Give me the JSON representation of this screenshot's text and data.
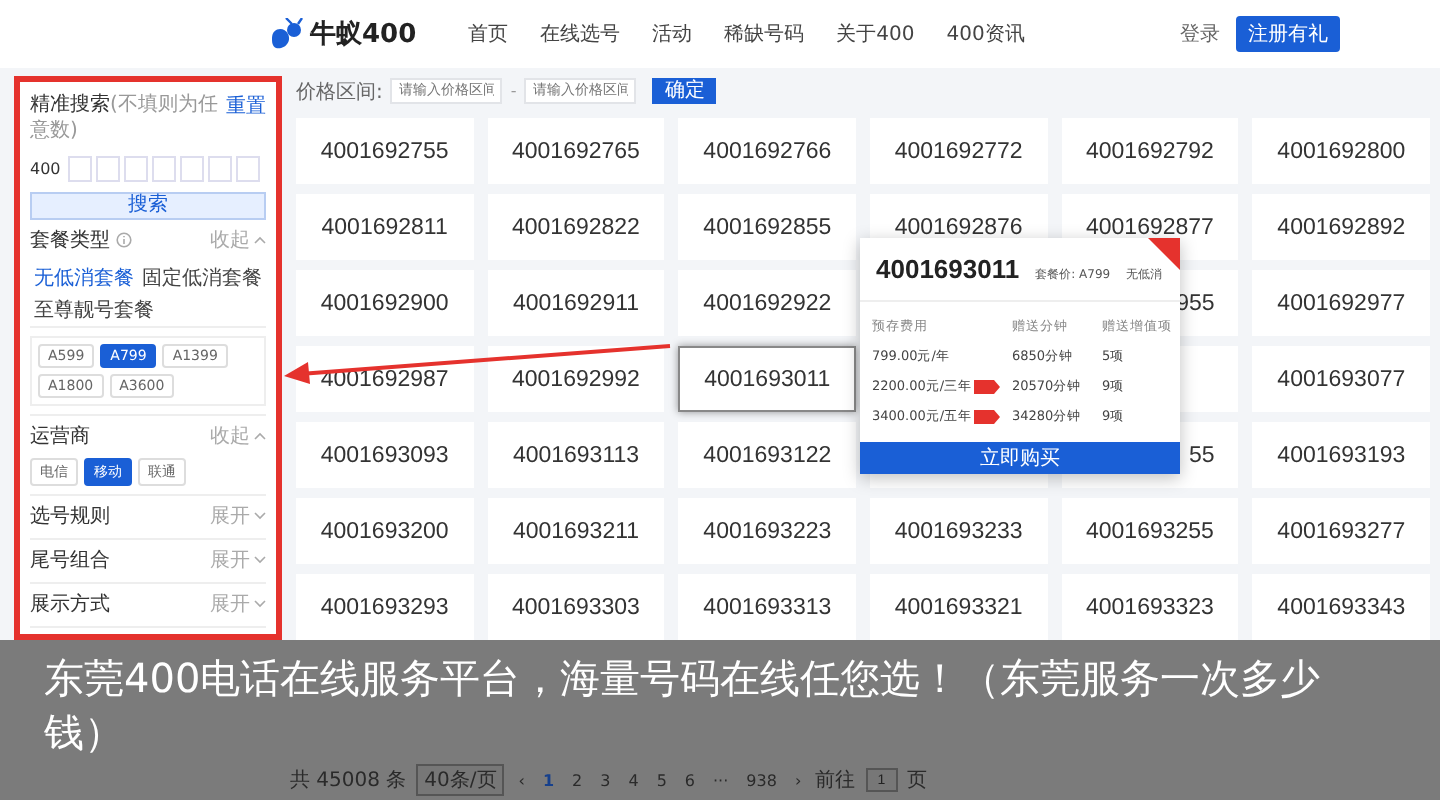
{
  "header": {
    "logo": "牛蚁400",
    "nav": [
      "首页",
      "在线选号",
      "活动",
      "稀缺号码",
      "关于400",
      "400资讯"
    ],
    "login": "登录",
    "register": "注册有礼"
  },
  "sidebar": {
    "search": {
      "title": "精准搜索",
      "hint": "(不填则为任意数)",
      "reset": "重置",
      "prefix": "400",
      "button": "搜索"
    },
    "sections": [
      {
        "title": "套餐类型",
        "info": true,
        "toggle": "收起",
        "expanded": true,
        "tabs": [
          {
            "label": "无低消套餐",
            "selected": true
          },
          {
            "label": "固定低消套餐",
            "selected": false
          },
          {
            "label": "至尊靓号套餐",
            "selected": false
          }
        ],
        "options": [
          {
            "label": "A599",
            "selected": false
          },
          {
            "label": "A799",
            "selected": true
          },
          {
            "label": "A1399",
            "selected": false
          },
          {
            "label": "A1800",
            "selected": false
          },
          {
            "label": "A3600",
            "selected": false
          }
        ]
      },
      {
        "title": "运营商",
        "info": false,
        "toggle": "收起",
        "expanded": true,
        "options": [
          {
            "label": "电信",
            "selected": false
          },
          {
            "label": "移动",
            "selected": true
          },
          {
            "label": "联通",
            "selected": false
          }
        ]
      },
      {
        "title": "选号规则",
        "info": false,
        "toggle": "展开",
        "expanded": false
      },
      {
        "title": "尾号组合",
        "info": false,
        "toggle": "展开",
        "expanded": false
      },
      {
        "title": "展示方式",
        "info": false,
        "toggle": "展开",
        "expanded": false
      }
    ]
  },
  "filter": {
    "label": "价格区间:",
    "min_placeholder": "请输入价格区间",
    "separator": "-",
    "max_placeholder": "请输入价格区间",
    "button": "确定"
  },
  "numbers": [
    {
      "kind": "full",
      "text": "4001692755",
      "selected": false
    },
    {
      "kind": "full",
      "text": "4001692765",
      "selected": false
    },
    {
      "kind": "full",
      "text": "4001692766",
      "selected": false
    },
    {
      "kind": "full",
      "text": "4001692772",
      "selected": false
    },
    {
      "kind": "full",
      "text": "4001692792",
      "selected": false
    },
    {
      "kind": "full",
      "text": "4001692800",
      "selected": false
    },
    {
      "kind": "full",
      "text": "4001692811",
      "selected": false
    },
    {
      "kind": "full",
      "text": "4001692822",
      "selected": false
    },
    {
      "kind": "full",
      "text": "4001692855",
      "selected": false
    },
    {
      "kind": "full",
      "text": "4001692876",
      "selected": false
    },
    {
      "kind": "full",
      "text": "4001692877",
      "selected": false
    },
    {
      "kind": "full",
      "text": "4001692892",
      "selected": false
    },
    {
      "kind": "full",
      "text": "4001692900",
      "selected": false
    },
    {
      "kind": "full",
      "text": "4001692911",
      "selected": false
    },
    {
      "kind": "full",
      "text": "4001692922",
      "selected": false
    },
    {
      "kind": "covered"
    },
    {
      "kind": "partial",
      "text": "955",
      "selected": false
    },
    {
      "kind": "full",
      "text": "4001692977",
      "selected": false
    },
    {
      "kind": "full",
      "text": "4001692987",
      "selected": false
    },
    {
      "kind": "full",
      "text": "4001692992",
      "selected": false
    },
    {
      "kind": "full",
      "text": "4001693011",
      "selected": true
    },
    {
      "kind": "covered"
    },
    {
      "kind": "hidden"
    },
    {
      "kind": "full",
      "text": "4001693077",
      "selected": false
    },
    {
      "kind": "full",
      "text": "4001693093",
      "selected": false
    },
    {
      "kind": "full",
      "text": "4001693113",
      "selected": false
    },
    {
      "kind": "full",
      "text": "4001693122",
      "selected": false
    },
    {
      "kind": "hidden"
    },
    {
      "kind": "partial",
      "text": "55",
      "selected": false
    },
    {
      "kind": "full",
      "text": "4001693193",
      "selected": false
    },
    {
      "kind": "full",
      "text": "4001693200",
      "selected": false
    },
    {
      "kind": "full",
      "text": "4001693211",
      "selected": false
    },
    {
      "kind": "full",
      "text": "4001693223",
      "selected": false
    },
    {
      "kind": "full",
      "text": "4001693233",
      "selected": false
    },
    {
      "kind": "full",
      "text": "4001693255",
      "selected": false
    },
    {
      "kind": "full",
      "text": "4001693277",
      "selected": false
    },
    {
      "kind": "full",
      "text": "4001693293",
      "selected": false
    },
    {
      "kind": "full",
      "text": "4001693303",
      "selected": false
    },
    {
      "kind": "full",
      "text": "4001693313",
      "selected": false
    },
    {
      "kind": "full",
      "text": "4001693321",
      "selected": false
    },
    {
      "kind": "full",
      "text": "4001693323",
      "selected": false
    },
    {
      "kind": "full",
      "text": "4001693343",
      "selected": false
    }
  ],
  "popup": {
    "number": "4001693011",
    "package": "套餐价: A799",
    "note": "无低消",
    "columns": [
      "预存费用",
      "赠送分钟",
      "赠送增值项"
    ],
    "rows": [
      {
        "price": "799.00元/年",
        "tag": false,
        "minutes": "6850分钟",
        "items": "5项"
      },
      {
        "price": "2200.00元/三年",
        "tag": true,
        "minutes": "20570分钟",
        "items": "9项"
      },
      {
        "price": "3400.00元/五年",
        "tag": true,
        "minutes": "34280分钟",
        "items": "9项"
      }
    ],
    "button": "立即购买"
  },
  "pagination": {
    "total": "共 45008 条",
    "page_size": "40条/页",
    "prev": "‹",
    "pages": [
      {
        "label": "1",
        "selected": true
      },
      {
        "label": "2",
        "selected": false
      },
      {
        "label": "3",
        "selected": false
      },
      {
        "label": "4",
        "selected": false
      },
      {
        "label": "5",
        "selected": false
      },
      {
        "label": "6",
        "selected": false
      },
      {
        "label": "···",
        "selected": false
      },
      {
        "label": "938",
        "selected": false
      }
    ],
    "next": "›",
    "goto": "前往",
    "goto_value": "1",
    "page_unit": "页"
  },
  "caption": "东莞400电话在线服务平台，海量号码在线任您选！（东莞服务一次多少钱）"
}
